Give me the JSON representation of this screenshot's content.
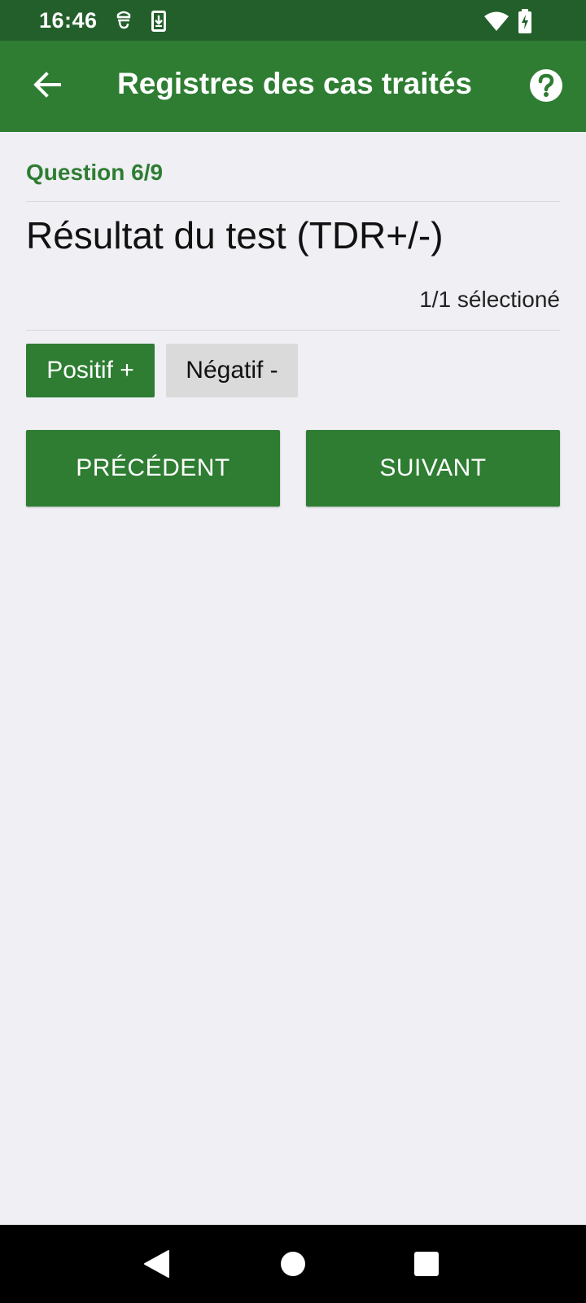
{
  "status_bar": {
    "time": "16:46",
    "left_icons": [
      "notification-icon",
      "download-icon"
    ],
    "right_icons": [
      "wifi-icon",
      "battery-charging-icon"
    ]
  },
  "app_bar": {
    "title": "Registres des cas traités",
    "back_icon": "arrow-left-icon",
    "help_icon": "help-circle-icon"
  },
  "question": {
    "counter": "Question 6/9",
    "title": "Résultat du test (TDR+/-)",
    "selection_count": "1/1 sélectioné",
    "options": [
      {
        "label": "Positif +",
        "selected": true
      },
      {
        "label": "Négatif -",
        "selected": false
      }
    ]
  },
  "navigation": {
    "previous_label": "PRÉCÉDENT",
    "next_label": "SUIVANT"
  },
  "system_nav": {
    "icons": [
      "back-triangle-icon",
      "home-circle-icon",
      "recents-square-icon"
    ]
  },
  "colors": {
    "primary": "#2e7d32",
    "status_bar": "#235f2a",
    "background": "#efeff4",
    "unselected_option": "#dadadb"
  }
}
